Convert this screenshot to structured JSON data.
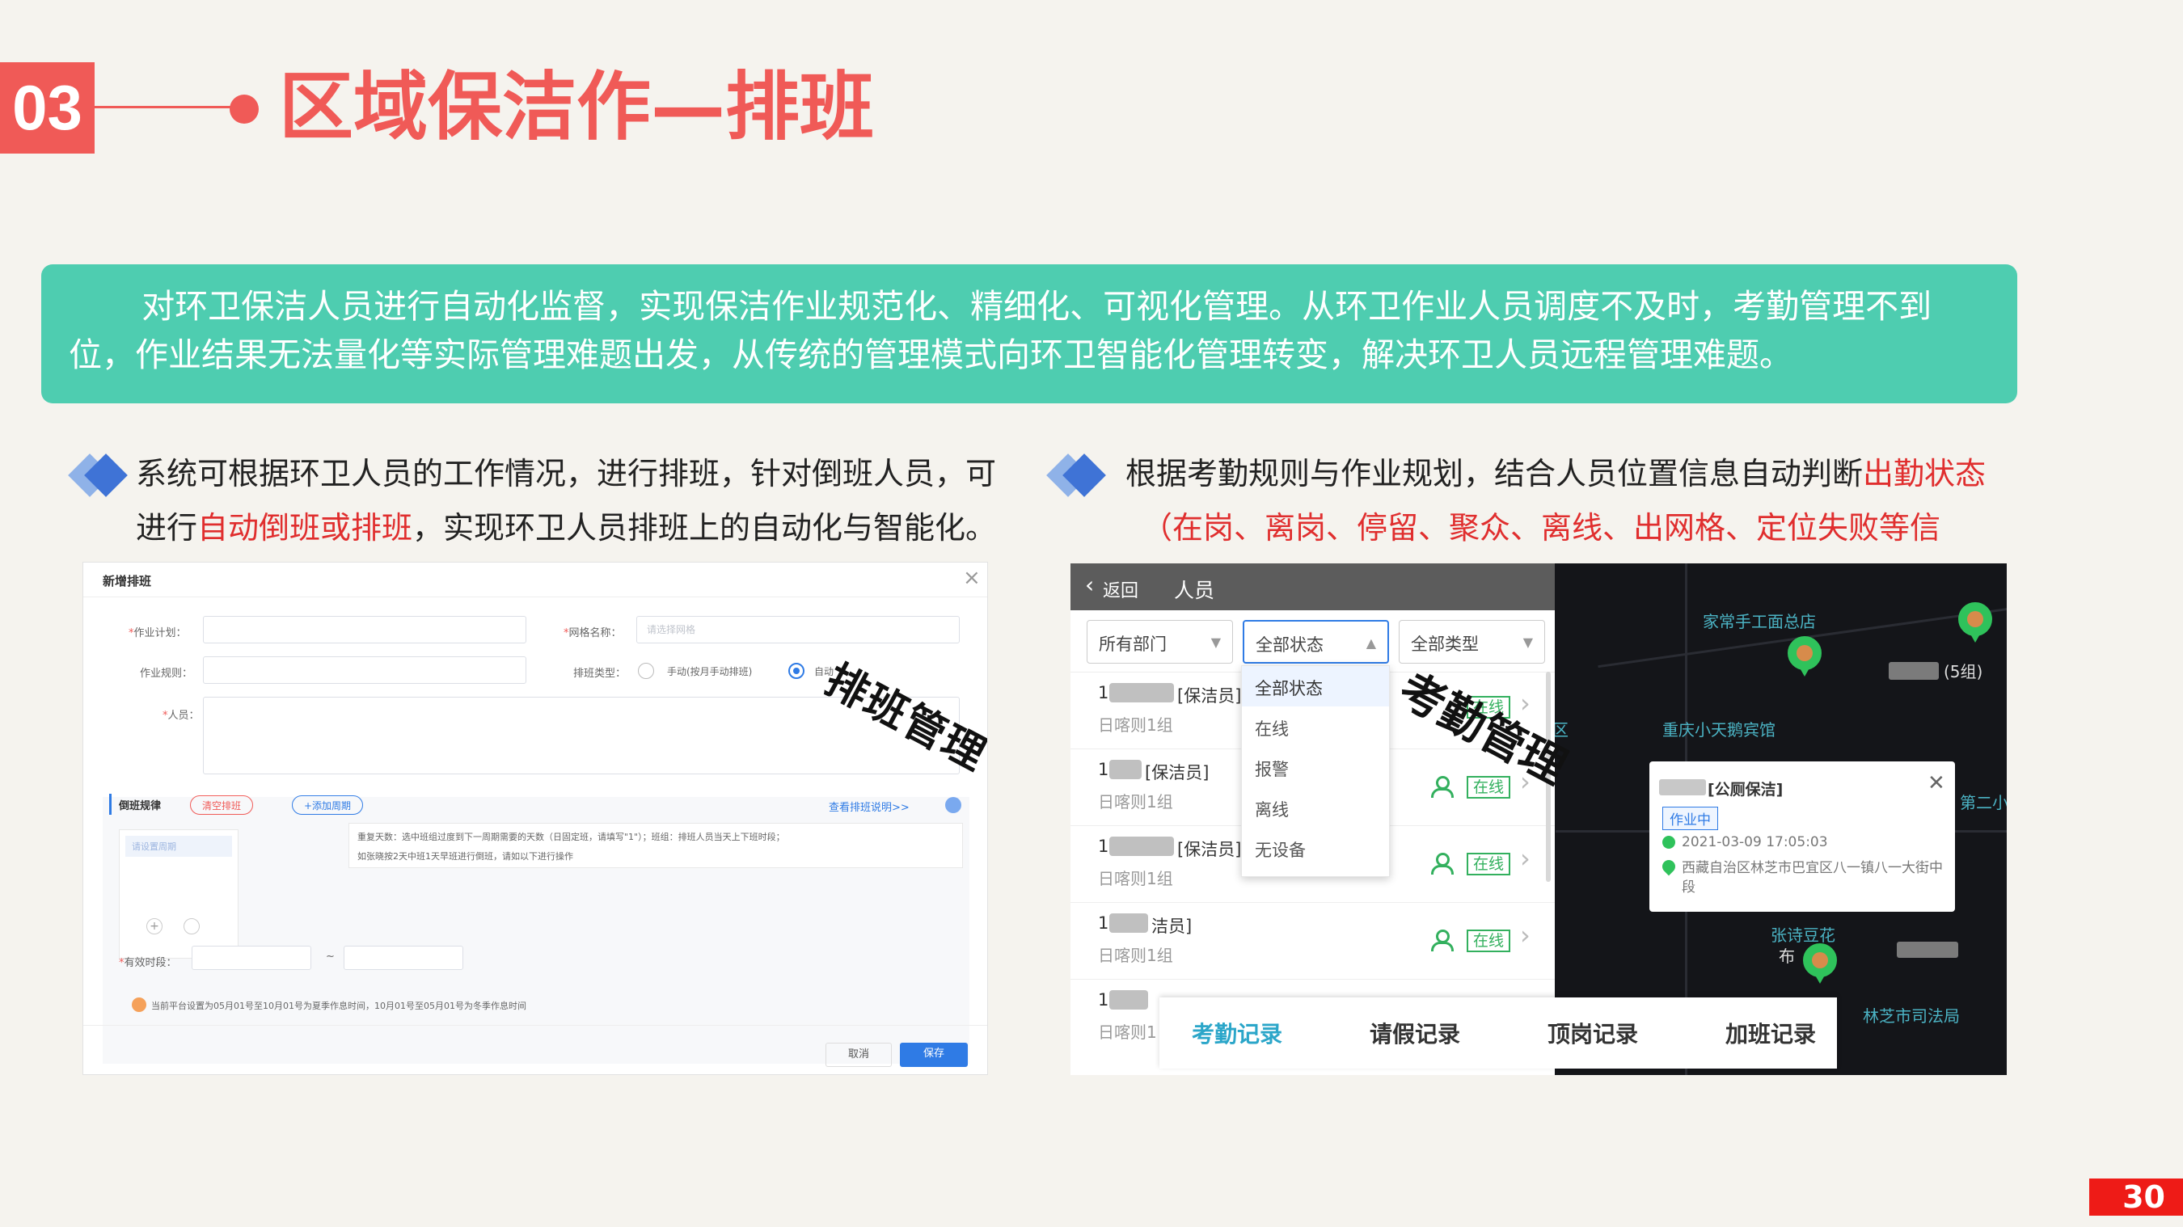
{
  "header": {
    "section_number": "03",
    "title": "区域保洁作—排班"
  },
  "intro": {
    "text": "对环卫保洁人员进行自动化监督，实现保洁作业规范化、精细化、可视化管理。从环卫作业人员调度不及时，考勤管理不到位，作业结果无法量化等实际管理难题出发，从传统的管理模式向环卫智能化管理转变，解决环卫人员远程管理难题。"
  },
  "left_point": {
    "line1": "系统可根据环卫人员的工作情况，进行排班，针对倒班人员，可",
    "line2_pre": "进行",
    "line2_red": "自动倒班或排班",
    "line2_post": "，实现环卫人员排班上的自动化与智能化。"
  },
  "right_point": {
    "line1_pre": "根据考勤规则与作业规划，结合人员位置信息自动判断",
    "line1_red": "出勤状态",
    "line2_red": "（在岗、离岗、停留、聚众、离线、出网格、定位失败等信息）",
    "line2_post": "。"
  },
  "schedule_dialog": {
    "title": "新增排班",
    "close": "×",
    "label_plan": "作业计划：",
    "label_grid": "网格名称：",
    "grid_placeholder": "请选择网格",
    "label_rule": "作业规则：",
    "label_type": "排班类型：",
    "type_manual": "手动(按月手动排班)",
    "type_auto": "自动",
    "label_person": "人员：",
    "shift_rule_label": "倒班规律",
    "clear_btn": "清空排班",
    "add_cycle_btn": "+添加周期",
    "help_link": "查看排班说明>>",
    "cycle_item": "请设置周期",
    "note_line1": "重复天数：选中班组过度到下一周期需要的天数（日固定班，请填写\"1\"）；班组：排班人员当天上下班时段；",
    "note_line2": "如张晓按2天中班1天早班进行倒班，请如以下进行操作",
    "label_valid": "有效时段：",
    "range_sep": "~",
    "season_note": "当前平台设置为05月01号至10月01号为夏季作息时间，10月01号至05月01号为冬季作息时间",
    "cancel": "取消",
    "save": "保存",
    "stamp": "排班管理"
  },
  "attendance_app": {
    "back": "返回",
    "title": "人员",
    "filter_dept": "所有部门",
    "filter_status": "全部状态",
    "filter_type": "全部类型",
    "status_options": [
      "全部状态",
      "在线",
      "报警",
      "离线",
      "无设备"
    ],
    "rows": [
      {
        "name": "[保洁员]",
        "sub": "日喀则1组",
        "status": "在线"
      },
      {
        "name": "[保洁员]",
        "sub": "日喀则1组",
        "status": "在线"
      },
      {
        "name": "[保洁员]",
        "sub": "日喀则1组",
        "status": "在线"
      },
      {
        "name": "洁员]",
        "sub": "日喀则1组",
        "status": "在线"
      },
      {
        "name": "",
        "sub": "日喀则1",
        "status": ""
      }
    ],
    "tabs": [
      "考勤记录",
      "请假记录",
      "顶岗记录",
      "加班记录"
    ],
    "stamp": "考勤管理",
    "map_labels": {
      "shop": "家常手工面总店",
      "hotel": "重庆小天鹅宾馆",
      "group": "(5组)",
      "district": "区",
      "school": "第二小学",
      "person": "张诗豆花",
      "court": "林芝市司法局",
      "extra": "布"
    },
    "popup": {
      "name": "[公厕保洁]",
      "state": "作业中",
      "time": "2021-03-09 17:05:03",
      "address": "西藏自治区林芝市巴宜区八一镇八一大街中段",
      "close": "✕"
    }
  },
  "page_number": "30",
  "colors": {
    "accent_red": "#f05a57",
    "banner_teal": "#4ecdb0",
    "bullet_blue": "#3f73d6",
    "online_green": "#33b05e"
  }
}
